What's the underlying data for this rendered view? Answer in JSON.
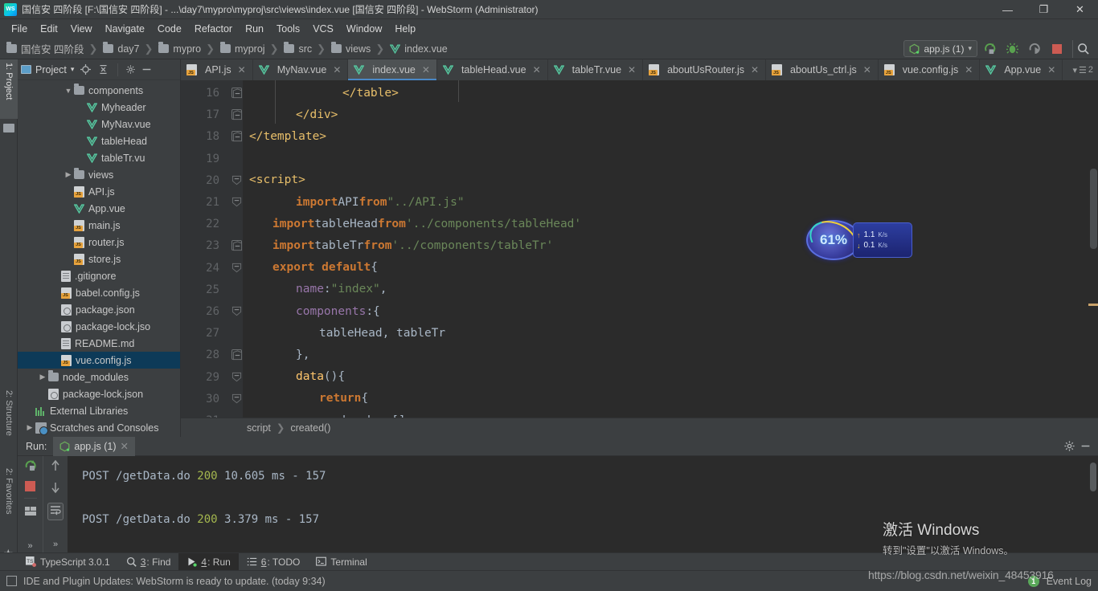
{
  "window": {
    "title": "国信安 四阶段 [F:\\国信安 四阶段] - ...\\day7\\mypro\\myproj\\src\\views\\index.vue [国信安 四阶段] - WebStorm (Administrator)",
    "minimize": "—",
    "maximize": "❐",
    "close": "✕"
  },
  "menu": {
    "items": [
      "File",
      "Edit",
      "View",
      "Navigate",
      "Code",
      "Refactor",
      "Run",
      "Tools",
      "VCS",
      "Window",
      "Help"
    ]
  },
  "breadcrumb": {
    "items": [
      {
        "label": "国信安 四阶段",
        "icon": "folder-icon"
      },
      {
        "label": "day7",
        "icon": "folder-icon"
      },
      {
        "label": "mypro",
        "icon": "folder-icon"
      },
      {
        "label": "myproj",
        "icon": "folder-icon"
      },
      {
        "label": "src",
        "icon": "folder-icon"
      },
      {
        "label": "views",
        "icon": "folder-icon"
      },
      {
        "label": "index.vue",
        "icon": "vue-icon"
      }
    ],
    "separator": "❯"
  },
  "run_toolbar": {
    "config_name": "app.js (1)",
    "config_caret": "▾",
    "run_icon": "run-icon",
    "debug_icon": "debug-icon",
    "run_with_coverage_icon": "run-coverage-icon",
    "stop_icon": "stop-icon",
    "search_icon": "search-everywhere-icon"
  },
  "editor_tabs": {
    "tabs": [
      {
        "label": "API.js",
        "icon": "js-icon",
        "active": false
      },
      {
        "label": "MyNav.vue",
        "icon": "vue-icon",
        "active": false
      },
      {
        "label": "index.vue",
        "icon": "vue-icon",
        "active": true
      },
      {
        "label": "tableHead.vue",
        "icon": "vue-icon",
        "active": false
      },
      {
        "label": "tableTr.vue",
        "icon": "vue-icon",
        "active": false
      },
      {
        "label": "aboutUsRouter.js",
        "icon": "js-icon",
        "active": false
      },
      {
        "label": "aboutUs_ctrl.js",
        "icon": "js-icon",
        "active": false
      },
      {
        "label": "vue.config.js",
        "icon": "js-icon",
        "active": false
      },
      {
        "label": "App.vue",
        "icon": "vue-icon",
        "active": false
      }
    ],
    "close_glyph": "✕",
    "overflow_count": "2"
  },
  "left_strip": {
    "tabs": [
      "1: Project",
      "2: Structure",
      "2: Favorites"
    ]
  },
  "project_panel": {
    "title": "Project",
    "caret": "▾",
    "locate_icon": "locate-icon",
    "collapse_icon": "collapse-all-icon",
    "settings_icon": "gear-icon",
    "hide_icon": "hide-icon",
    "tree": [
      {
        "label": "components",
        "icon": "folder-icon",
        "arrow": "▼",
        "depth": 3,
        "selected": false
      },
      {
        "label": "Myheader",
        "icon": "vue-icon",
        "arrow": "",
        "depth": 4,
        "selected": false
      },
      {
        "label": "MyNav.vue",
        "icon": "vue-icon",
        "arrow": "",
        "depth": 4,
        "selected": false
      },
      {
        "label": "tableHead",
        "icon": "vue-icon",
        "arrow": "",
        "depth": 4,
        "selected": false
      },
      {
        "label": "tableTr.vu",
        "icon": "vue-icon",
        "arrow": "",
        "depth": 4,
        "selected": false
      },
      {
        "label": "views",
        "icon": "folder-icon",
        "arrow": "▶",
        "depth": 3,
        "selected": false
      },
      {
        "label": "API.js",
        "icon": "js-icon",
        "arrow": "",
        "depth": 3,
        "selected": false
      },
      {
        "label": "App.vue",
        "icon": "vue-icon",
        "arrow": "",
        "depth": 3,
        "selected": false
      },
      {
        "label": "main.js",
        "icon": "js-icon",
        "arrow": "",
        "depth": 3,
        "selected": false
      },
      {
        "label": "router.js",
        "icon": "js-icon",
        "arrow": "",
        "depth": 3,
        "selected": false
      },
      {
        "label": "store.js",
        "icon": "js-icon",
        "arrow": "",
        "depth": 3,
        "selected": false
      },
      {
        "label": ".gitignore",
        "icon": "file-icon",
        "arrow": "",
        "depth": 2,
        "selected": false
      },
      {
        "label": "babel.config.js",
        "icon": "js-icon",
        "arrow": "",
        "depth": 2,
        "selected": false
      },
      {
        "label": "package.json",
        "icon": "json-icon",
        "arrow": "",
        "depth": 2,
        "selected": false
      },
      {
        "label": "package-lock.jso",
        "icon": "json-icon",
        "arrow": "",
        "depth": 2,
        "selected": false
      },
      {
        "label": "README.md",
        "icon": "file-icon",
        "arrow": "",
        "depth": 2,
        "selected": false
      },
      {
        "label": "vue.config.js",
        "icon": "js-icon",
        "arrow": "",
        "depth": 2,
        "selected": true
      },
      {
        "label": "node_modules",
        "icon": "folder-icon",
        "arrow": "▶",
        "depth": 1,
        "selected": false
      },
      {
        "label": "package-lock.json",
        "icon": "json-icon",
        "arrow": "",
        "depth": 1,
        "selected": false
      },
      {
        "label": "External Libraries",
        "icon": "libraries-icon",
        "arrow": "",
        "depth": 0,
        "selected": false
      },
      {
        "label": "Scratches and Consoles",
        "icon": "scratches-icon",
        "arrow": "▶",
        "depth": 0,
        "selected": false
      }
    ]
  },
  "editor": {
    "file": "index.vue",
    "first_line": 16,
    "lines": [
      {
        "n": "16",
        "fold": "minus",
        "indent": 4,
        "tokens": [
          {
            "t": "</table>",
            "c": "tag"
          }
        ]
      },
      {
        "n": "17",
        "fold": "minus",
        "indent": 2,
        "tokens": [
          {
            "t": "</div>",
            "c": "tag"
          }
        ]
      },
      {
        "n": "18",
        "fold": "minus",
        "indent": 0,
        "tokens": [
          {
            "t": "</template>",
            "c": "tag"
          }
        ]
      },
      {
        "n": "19",
        "fold": "",
        "indent": 0,
        "tokens": []
      },
      {
        "n": "20",
        "fold": "tri",
        "indent": 0,
        "tokens": [
          {
            "t": "<script>",
            "c": "tag"
          }
        ]
      },
      {
        "n": "21",
        "fold": "tri",
        "indent": 2,
        "tokens": [
          {
            "t": "import ",
            "c": "kw"
          },
          {
            "t": "API ",
            "c": "id"
          },
          {
            "t": "from ",
            "c": "kw"
          },
          {
            "t": "\"../API.js\"",
            "c": "str"
          }
        ]
      },
      {
        "n": "22",
        "fold": "",
        "indent": 1,
        "tokens": [
          {
            "t": "import ",
            "c": "kw"
          },
          {
            "t": "tableHead ",
            "c": "id"
          },
          {
            "t": "from ",
            "c": "kw"
          },
          {
            "t": "'../components/tableHead'",
            "c": "str"
          }
        ]
      },
      {
        "n": "23",
        "fold": "minus",
        "indent": 1,
        "tokens": [
          {
            "t": "import ",
            "c": "kw"
          },
          {
            "t": "tableTr ",
            "c": "id"
          },
          {
            "t": "from ",
            "c": "kw"
          },
          {
            "t": "'../components/tableTr'",
            "c": "str"
          }
        ]
      },
      {
        "n": "24",
        "fold": "tri",
        "indent": 1,
        "tokens": [
          {
            "t": "export default ",
            "c": "kw"
          },
          {
            "t": "{",
            "c": "plain"
          }
        ]
      },
      {
        "n": "25",
        "fold": "",
        "indent": 2,
        "tokens": [
          {
            "t": "name",
            "c": "prop"
          },
          {
            "t": ": ",
            "c": "plain"
          },
          {
            "t": "\"index\"",
            "c": "str"
          },
          {
            "t": ",",
            "c": "plain"
          }
        ]
      },
      {
        "n": "26",
        "fold": "tri",
        "indent": 2,
        "tokens": [
          {
            "t": "components",
            "c": "prop"
          },
          {
            "t": ":{",
            "c": "plain"
          }
        ]
      },
      {
        "n": "27",
        "fold": "",
        "indent": 3,
        "tokens": [
          {
            "t": "tableHead, tableTr",
            "c": "id"
          }
        ]
      },
      {
        "n": "28",
        "fold": "minus",
        "indent": 2,
        "tokens": [
          {
            "t": "},",
            "c": "plain"
          }
        ]
      },
      {
        "n": "29",
        "fold": "tri",
        "indent": 2,
        "tokens": [
          {
            "t": "data",
            "c": "fn"
          },
          {
            "t": "(){",
            "c": "plain"
          }
        ]
      },
      {
        "n": "30",
        "fold": "tri",
        "indent": 3,
        "tokens": [
          {
            "t": "return",
            "c": "kw"
          },
          {
            "t": "{",
            "c": "plain"
          }
        ]
      },
      {
        "n": "31",
        "fold": "",
        "indent": 4,
        "tokens": [
          {
            "t": "header:[]",
            "c": "id"
          }
        ]
      }
    ]
  },
  "editor_breadcrumb": {
    "items": [
      "script",
      "created()"
    ],
    "separator": "❯"
  },
  "run_window": {
    "label": "Run:",
    "tab": "app.js (1)",
    "tab_close": "✕",
    "settings_icon": "gear-icon",
    "hide_icon": "hide-icon",
    "rerun_icon": "rerun-icon",
    "stop_icon": "stop-icon",
    "print_icon": "print-icon",
    "up_icon": "scroll-up-icon",
    "down_icon": "scroll-down-icon",
    "soft_wrap_icon": "soft-wrap-icon",
    "more_icon": "»",
    "console_lines": [
      {
        "prefix": "POST /getData.do ",
        "status": "200",
        "rest": " 10.605 ms - 157"
      },
      {
        "prefix": "POST /getData.do ",
        "status": "200",
        "rest": " 3.379 ms - 157"
      }
    ]
  },
  "bottom_toolbar": {
    "items": [
      {
        "label": "TypeScript 3.0.1",
        "icon": "typescript-icon",
        "key": "",
        "selected": false
      },
      {
        "label": ": Find",
        "icon": "search-icon",
        "key": "3",
        "selected": false
      },
      {
        "label": ": Run",
        "icon": "run-icon",
        "key": "4",
        "selected": true
      },
      {
        "label": ": TODO",
        "icon": "todo-icon",
        "key": "6",
        "selected": false
      },
      {
        "label": "Terminal",
        "icon": "terminal-icon",
        "key": "",
        "selected": false
      }
    ]
  },
  "status_bar": {
    "message": "IDE and Plugin Updates: WebStorm is ready to update. (today 9:34)",
    "event_log": "Event Log",
    "event_count": "1"
  },
  "overlays": {
    "activate_windows_title": "激活 Windows",
    "activate_windows_sub": "转到\"设置\"以激活 Windows。",
    "watermark": "https://blog.csdn.net/weixin_48453916"
  },
  "net_widget": {
    "percent": "61%",
    "up_arrow": "↑",
    "up_value": "1.1",
    "up_unit": "K/s",
    "down_arrow": "↓",
    "down_value": "0.1",
    "down_unit": "K/s"
  },
  "colors": {
    "accent": "#4a88c7",
    "selection": "#0d3a58",
    "panel": "#3c3f41",
    "editor_bg": "#2b2b2b",
    "keyword": "#cc7832",
    "string": "#6a8759",
    "tag": "#e8bf6a"
  }
}
